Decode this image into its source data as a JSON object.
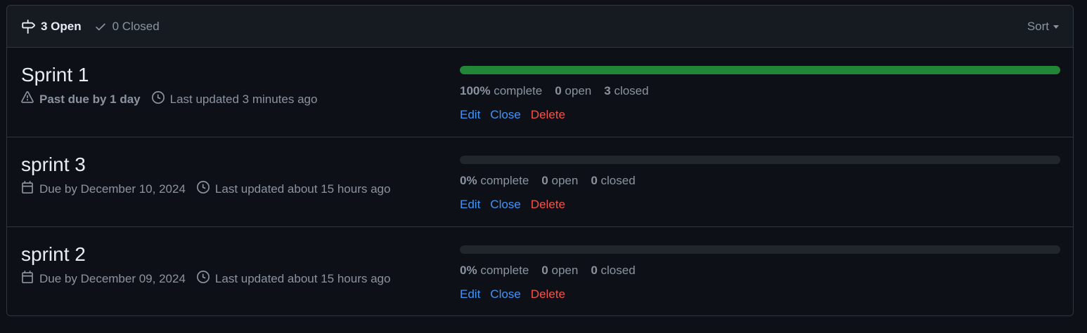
{
  "header": {
    "open_label": "3 Open",
    "closed_label": "0 Closed",
    "sort_label": "Sort"
  },
  "milestones": [
    {
      "title": "Sprint 1",
      "due_text": "Past due by 1 day",
      "due_type": "past-due",
      "updated_text": "Last updated 3 minutes ago",
      "progress_percent": 100,
      "percent_label": "100%",
      "complete_label": "complete",
      "open_count": "0",
      "open_label": "open",
      "closed_count": "3",
      "closed_label": "closed",
      "actions": {
        "edit": "Edit",
        "close": "Close",
        "delete": "Delete"
      }
    },
    {
      "title": "sprint 3",
      "due_text": "Due by December 10, 2024",
      "due_type": "due",
      "updated_text": "Last updated about 15 hours ago",
      "progress_percent": 0,
      "percent_label": "0%",
      "complete_label": "complete",
      "open_count": "0",
      "open_label": "open",
      "closed_count": "0",
      "closed_label": "closed",
      "actions": {
        "edit": "Edit",
        "close": "Close",
        "delete": "Delete"
      }
    },
    {
      "title": "sprint 2",
      "due_text": "Due by December 09, 2024",
      "due_type": "due",
      "updated_text": "Last updated about 15 hours ago",
      "progress_percent": 0,
      "percent_label": "0%",
      "complete_label": "complete",
      "open_count": "0",
      "open_label": "open",
      "closed_count": "0",
      "closed_label": "closed",
      "actions": {
        "edit": "Edit",
        "close": "Close",
        "delete": "Delete"
      }
    }
  ],
  "icons": {
    "open": "milestone-icon",
    "closed": "check-icon",
    "past_due": "alert-icon",
    "due": "calendar-icon",
    "updated": "clock-icon"
  },
  "colors": {
    "background": "#0d1117",
    "header_bg": "#161b22",
    "border": "#30363d",
    "progress": "#238636",
    "progress_track": "#21262d",
    "link": "#4493f8",
    "danger": "#f85149",
    "muted": "#8b949e"
  }
}
